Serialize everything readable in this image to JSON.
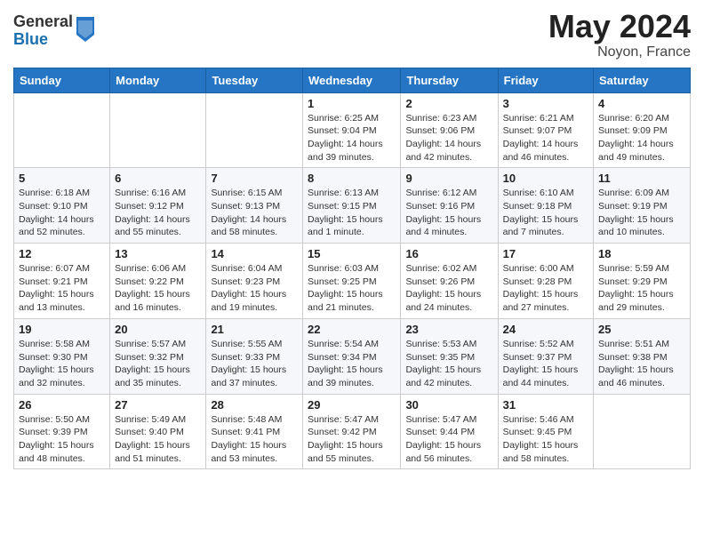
{
  "header": {
    "logo_general": "General",
    "logo_blue": "Blue",
    "title": "May 2024",
    "location": "Noyon, France"
  },
  "days_of_week": [
    "Sunday",
    "Monday",
    "Tuesday",
    "Wednesday",
    "Thursday",
    "Friday",
    "Saturday"
  ],
  "weeks": [
    [
      null,
      null,
      null,
      {
        "day": "1",
        "sunrise": "Sunrise: 6:25 AM",
        "sunset": "Sunset: 9:04 PM",
        "daylight": "Daylight: 14 hours and 39 minutes."
      },
      {
        "day": "2",
        "sunrise": "Sunrise: 6:23 AM",
        "sunset": "Sunset: 9:06 PM",
        "daylight": "Daylight: 14 hours and 42 minutes."
      },
      {
        "day": "3",
        "sunrise": "Sunrise: 6:21 AM",
        "sunset": "Sunset: 9:07 PM",
        "daylight": "Daylight: 14 hours and 46 minutes."
      },
      {
        "day": "4",
        "sunrise": "Sunrise: 6:20 AM",
        "sunset": "Sunset: 9:09 PM",
        "daylight": "Daylight: 14 hours and 49 minutes."
      }
    ],
    [
      {
        "day": "5",
        "sunrise": "Sunrise: 6:18 AM",
        "sunset": "Sunset: 9:10 PM",
        "daylight": "Daylight: 14 hours and 52 minutes."
      },
      {
        "day": "6",
        "sunrise": "Sunrise: 6:16 AM",
        "sunset": "Sunset: 9:12 PM",
        "daylight": "Daylight: 14 hours and 55 minutes."
      },
      {
        "day": "7",
        "sunrise": "Sunrise: 6:15 AM",
        "sunset": "Sunset: 9:13 PM",
        "daylight": "Daylight: 14 hours and 58 minutes."
      },
      {
        "day": "8",
        "sunrise": "Sunrise: 6:13 AM",
        "sunset": "Sunset: 9:15 PM",
        "daylight": "Daylight: 15 hours and 1 minute."
      },
      {
        "day": "9",
        "sunrise": "Sunrise: 6:12 AM",
        "sunset": "Sunset: 9:16 PM",
        "daylight": "Daylight: 15 hours and 4 minutes."
      },
      {
        "day": "10",
        "sunrise": "Sunrise: 6:10 AM",
        "sunset": "Sunset: 9:18 PM",
        "daylight": "Daylight: 15 hours and 7 minutes."
      },
      {
        "day": "11",
        "sunrise": "Sunrise: 6:09 AM",
        "sunset": "Sunset: 9:19 PM",
        "daylight": "Daylight: 15 hours and 10 minutes."
      }
    ],
    [
      {
        "day": "12",
        "sunrise": "Sunrise: 6:07 AM",
        "sunset": "Sunset: 9:21 PM",
        "daylight": "Daylight: 15 hours and 13 minutes."
      },
      {
        "day": "13",
        "sunrise": "Sunrise: 6:06 AM",
        "sunset": "Sunset: 9:22 PM",
        "daylight": "Daylight: 15 hours and 16 minutes."
      },
      {
        "day": "14",
        "sunrise": "Sunrise: 6:04 AM",
        "sunset": "Sunset: 9:23 PM",
        "daylight": "Daylight: 15 hours and 19 minutes."
      },
      {
        "day": "15",
        "sunrise": "Sunrise: 6:03 AM",
        "sunset": "Sunset: 9:25 PM",
        "daylight": "Daylight: 15 hours and 21 minutes."
      },
      {
        "day": "16",
        "sunrise": "Sunrise: 6:02 AM",
        "sunset": "Sunset: 9:26 PM",
        "daylight": "Daylight: 15 hours and 24 minutes."
      },
      {
        "day": "17",
        "sunrise": "Sunrise: 6:00 AM",
        "sunset": "Sunset: 9:28 PM",
        "daylight": "Daylight: 15 hours and 27 minutes."
      },
      {
        "day": "18",
        "sunrise": "Sunrise: 5:59 AM",
        "sunset": "Sunset: 9:29 PM",
        "daylight": "Daylight: 15 hours and 29 minutes."
      }
    ],
    [
      {
        "day": "19",
        "sunrise": "Sunrise: 5:58 AM",
        "sunset": "Sunset: 9:30 PM",
        "daylight": "Daylight: 15 hours and 32 minutes."
      },
      {
        "day": "20",
        "sunrise": "Sunrise: 5:57 AM",
        "sunset": "Sunset: 9:32 PM",
        "daylight": "Daylight: 15 hours and 35 minutes."
      },
      {
        "day": "21",
        "sunrise": "Sunrise: 5:55 AM",
        "sunset": "Sunset: 9:33 PM",
        "daylight": "Daylight: 15 hours and 37 minutes."
      },
      {
        "day": "22",
        "sunrise": "Sunrise: 5:54 AM",
        "sunset": "Sunset: 9:34 PM",
        "daylight": "Daylight: 15 hours and 39 minutes."
      },
      {
        "day": "23",
        "sunrise": "Sunrise: 5:53 AM",
        "sunset": "Sunset: 9:35 PM",
        "daylight": "Daylight: 15 hours and 42 minutes."
      },
      {
        "day": "24",
        "sunrise": "Sunrise: 5:52 AM",
        "sunset": "Sunset: 9:37 PM",
        "daylight": "Daylight: 15 hours and 44 minutes."
      },
      {
        "day": "25",
        "sunrise": "Sunrise: 5:51 AM",
        "sunset": "Sunset: 9:38 PM",
        "daylight": "Daylight: 15 hours and 46 minutes."
      }
    ],
    [
      {
        "day": "26",
        "sunrise": "Sunrise: 5:50 AM",
        "sunset": "Sunset: 9:39 PM",
        "daylight": "Daylight: 15 hours and 48 minutes."
      },
      {
        "day": "27",
        "sunrise": "Sunrise: 5:49 AM",
        "sunset": "Sunset: 9:40 PM",
        "daylight": "Daylight: 15 hours and 51 minutes."
      },
      {
        "day": "28",
        "sunrise": "Sunrise: 5:48 AM",
        "sunset": "Sunset: 9:41 PM",
        "daylight": "Daylight: 15 hours and 53 minutes."
      },
      {
        "day": "29",
        "sunrise": "Sunrise: 5:47 AM",
        "sunset": "Sunset: 9:42 PM",
        "daylight": "Daylight: 15 hours and 55 minutes."
      },
      {
        "day": "30",
        "sunrise": "Sunrise: 5:47 AM",
        "sunset": "Sunset: 9:44 PM",
        "daylight": "Daylight: 15 hours and 56 minutes."
      },
      {
        "day": "31",
        "sunrise": "Sunrise: 5:46 AM",
        "sunset": "Sunset: 9:45 PM",
        "daylight": "Daylight: 15 hours and 58 minutes."
      },
      null
    ]
  ]
}
